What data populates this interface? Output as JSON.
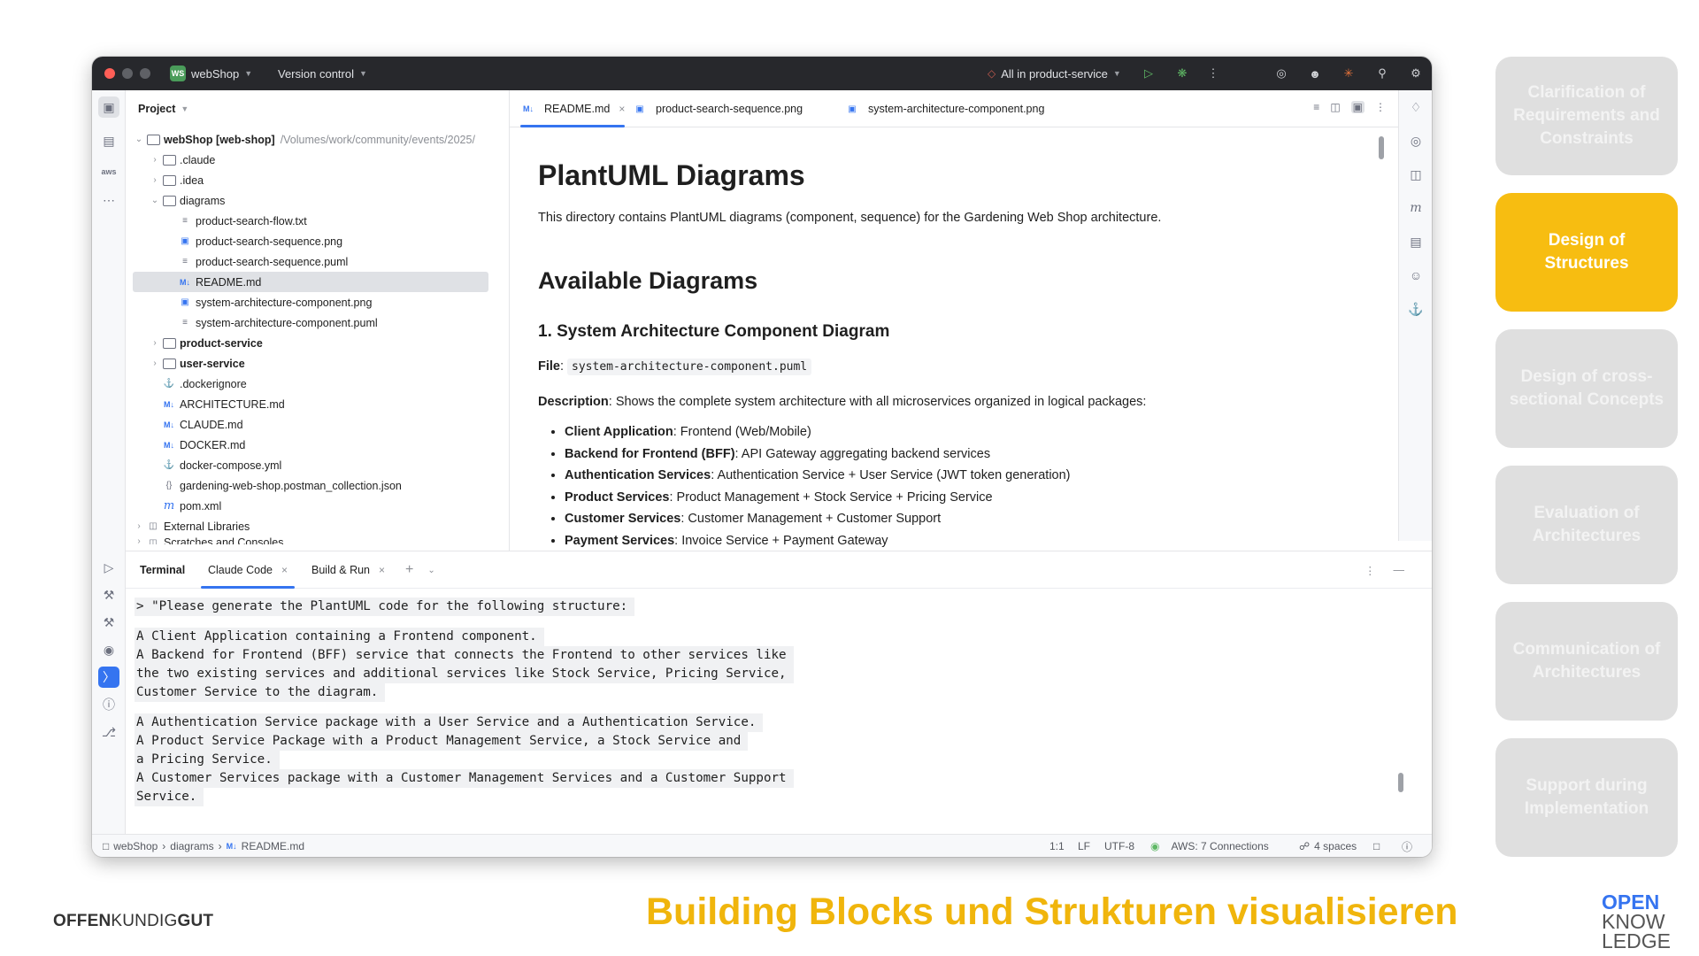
{
  "titlebar": {
    "project_badge": "WS",
    "project_name": "webShop",
    "vcs": "Version control",
    "run_config": "All in product-service"
  },
  "project_panel": {
    "title": "Project",
    "root_name": "webShop [web-shop]",
    "root_path": "/Volumes/work/community/events/2025/",
    "items": [
      {
        "label": ".claude"
      },
      {
        "label": ".idea"
      },
      {
        "label": "diagrams"
      },
      {
        "label": "product-search-flow.txt"
      },
      {
        "label": "product-search-sequence.png"
      },
      {
        "label": "product-search-sequence.puml"
      },
      {
        "label": "README.md"
      },
      {
        "label": "system-architecture-component.png"
      },
      {
        "label": "system-architecture-component.puml"
      },
      {
        "label": "product-service"
      },
      {
        "label": "user-service"
      },
      {
        "label": ".dockerignore"
      },
      {
        "label": "ARCHITECTURE.md"
      },
      {
        "label": "CLAUDE.md"
      },
      {
        "label": "DOCKER.md"
      },
      {
        "label": "docker-compose.yml"
      },
      {
        "label": "gardening-web-shop.postman_collection.json"
      },
      {
        "label": "pom.xml"
      },
      {
        "label": "External Libraries"
      },
      {
        "label": "Scratches and Consoles"
      }
    ]
  },
  "editor_tabs": [
    {
      "label": "README.md"
    },
    {
      "label": "product-search-sequence.png"
    },
    {
      "label": "system-architecture-component.png"
    }
  ],
  "readme": {
    "h1": "PlantUML Diagrams",
    "intro": "This directory contains PlantUML diagrams (component, sequence) for the Gardening Web Shop architecture.",
    "h2": "Available Diagrams",
    "h3": "1. System Architecture Component Diagram",
    "file_label": "File",
    "file_sep": ":",
    "file_code": "system-architecture-component.puml",
    "desc_label": "Description",
    "desc_text": ": Shows the complete system architecture with all microservices organized in logical packages:",
    "bullets": [
      {
        "b": "Client Application",
        "t": ": Frontend (Web/Mobile)"
      },
      {
        "b": "Backend for Frontend (BFF)",
        "t": ": API Gateway aggregating backend services"
      },
      {
        "b": "Authentication Services",
        "t": ": Authentication Service + User Service (JWT token generation)"
      },
      {
        "b": "Product Services",
        "t": ": Product Management + Stock Service + Pricing Service"
      },
      {
        "b": "Customer Services",
        "t": ": Customer Management + Customer Support"
      },
      {
        "b": "Payment Services",
        "t": ": Invoice Service + Payment Gateway"
      }
    ]
  },
  "bottom_tabs": {
    "terminal": "Terminal",
    "claude": "Claude Code",
    "build": "Build & Run"
  },
  "terminal_lines": [
    "> \"Please generate the PlantUML code for the following structure:",
    "A Client Application containing a Frontend component.",
    "A Backend for Frontend (BFF) service that connects the Frontend to other services like",
    "the two existing services and additional services like Stock Service, Pricing Service,",
    "Customer Service to the diagram.",
    "A Authentication Service package with a User Service and a Authentication Service.",
    "A Product Service Package with a Product Management Service, a Stock Service and",
    "a Pricing Service.",
    "A Customer Services package with a Customer Management Services and a Customer Support",
    "Service."
  ],
  "statusbar": {
    "crumb1": "webShop",
    "crumb2": "diagrams",
    "crumb3": "README.md",
    "pos": "1:1",
    "le": "LF",
    "enc": "UTF-8",
    "aws": "AWS: 7 Connections",
    "indent": "4 spaces"
  },
  "slide_nav": [
    {
      "label": "Clarification of Requirements and Constraints"
    },
    {
      "label": "Design of Structures"
    },
    {
      "label": "Design of cross-sectional Concepts"
    },
    {
      "label": "Evaluation of Architectures"
    },
    {
      "label": "Communication of Architectures"
    },
    {
      "label": "Support during Implementation"
    }
  ],
  "footer": {
    "brand_a": "OFFEN",
    "brand_b": "KUNDIG",
    "brand_c": "GUT",
    "title": "Building Blocks und Strukturen visualisieren",
    "logo_1": "OPEN",
    "logo_2": "KNOW",
    "logo_3": "LEDGE"
  },
  "colors": {
    "accent": "#3574f0",
    "nav_active": "#f7bd11",
    "nav_inactive": "#dfdfdf",
    "title_yellow": "#f0b50c"
  }
}
